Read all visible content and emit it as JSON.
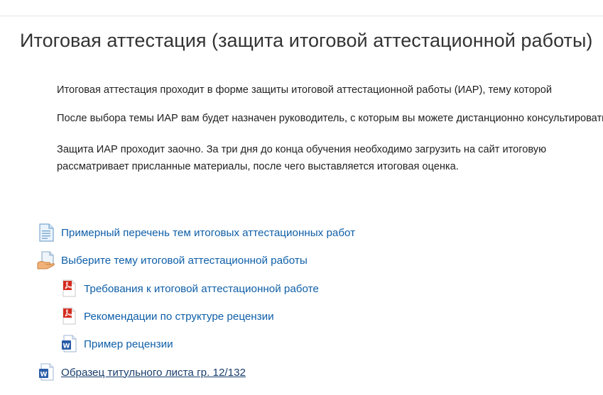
{
  "section": {
    "title": "Итоговая аттестация (защита итоговой аттестационной работы)"
  },
  "summary": {
    "p1": "Итоговая аттестация проходит в форме защиты итоговой аттестационной работы (ИАР), тему которой",
    "p2": "После выбора темы ИАР вам будет назначен руководитель, с которым вы можете дистанционно консультироваться",
    "p3": "Защита ИАР проходит заочно. За три дня до конца обучения необходимо загрузить на сайт итоговую",
    "p4": "рассматривает присланные материалы, после чего выставляется итоговая оценка."
  },
  "activities": [
    {
      "label": "Примерный перечень тем итоговых аттестационных работ",
      "icon": "page-icon"
    },
    {
      "label": "Выберите тему итоговой аттестационной работы",
      "icon": "choice-icon"
    },
    {
      "label": "Требования к итоговой аттестационной работе",
      "icon": "pdf-icon"
    },
    {
      "label": "Рекомендации по структуре рецензии",
      "icon": "pdf-icon"
    },
    {
      "label": "Пример рецензии",
      "icon": "word-icon"
    },
    {
      "label": "Образец титульного листа гр. 12/132",
      "icon": "word-icon"
    }
  ],
  "colors": {
    "link": "#0f5fa8",
    "pdf": "#d42b1e",
    "word": "#2a5ea8"
  }
}
